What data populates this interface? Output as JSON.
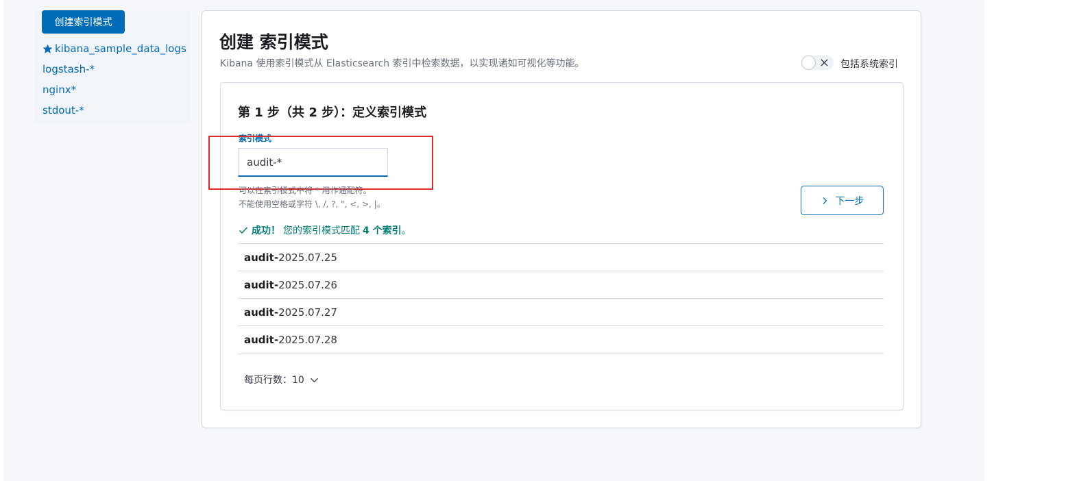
{
  "sidebar": {
    "create_button": "创建索引模式",
    "items": [
      {
        "label": "kibana_sample_data_logs",
        "starred": true
      },
      {
        "label": "logstash-*",
        "starred": false
      },
      {
        "label": "nginx*",
        "starred": false
      },
      {
        "label": "stdout-*",
        "starred": false
      }
    ]
  },
  "header": {
    "title": "创建 索引模式",
    "description": "Kibana 使用索引模式从 Elasticsearch 索引中检索数据，以实现诸如可视化等功能。",
    "toggle_label": "包括系统索引",
    "toggle_on": false
  },
  "step": {
    "title": "第 1 步（共 2 步）：定义索引模式",
    "field_label": "索引模式",
    "input_value": "audit-*",
    "help_line1": "可以在索引模式中将 * 用作通配符。",
    "help_line2": "不能使用空格或字符 \\, /, ?, \", <, >, |。",
    "next_button": "下一步",
    "success_prefix": "成功！",
    "success_middle": "您的索引模式匹配",
    "success_count": "4 个索引",
    "success_suffix": "。",
    "indices": [
      {
        "match": "audit-",
        "rest": "2025.07.25"
      },
      {
        "match": "audit-",
        "rest": "2025.07.26"
      },
      {
        "match": "audit-",
        "rest": "2025.07.27"
      },
      {
        "match": "audit-",
        "rest": "2025.07.28"
      }
    ],
    "rows_per_page": "每页行数：10"
  },
  "colors": {
    "accent": "#006bb8",
    "success": "#017d73",
    "highlight": "#e02a2a"
  }
}
